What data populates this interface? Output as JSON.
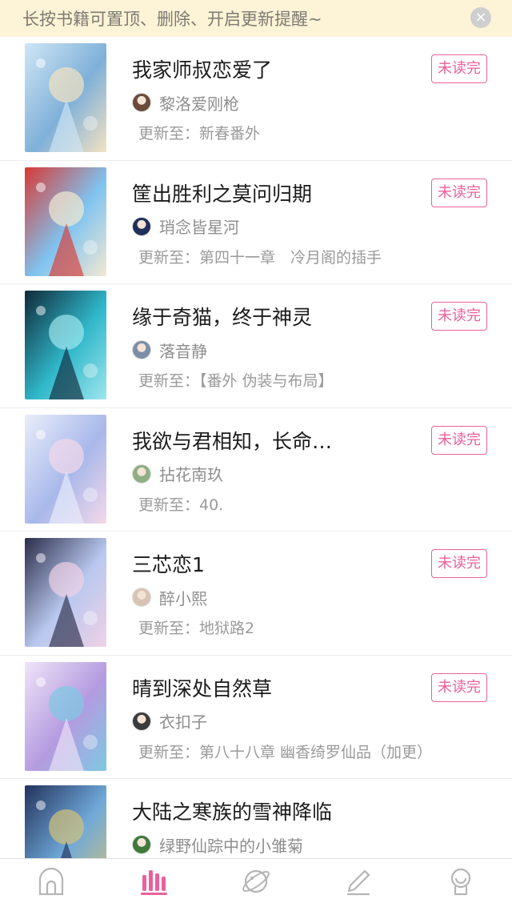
{
  "tip": {
    "text": "长按书籍可置顶、删除、开启更新提醒~",
    "close_icon": "×"
  },
  "books": [
    {
      "title": "我家师叔恋爱了",
      "author": "黎洛爱刚枪",
      "update": "更新至：新春番外",
      "badge": "未读完",
      "cover_colors": [
        "#cfe6f5",
        "#7fb0d9",
        "#f4e2c2"
      ],
      "avatar_color": "#6b4a3a"
    },
    {
      "title": "筐出胜利之莫问归期",
      "author": "琑念皆星河",
      "update": "更新至：第四十一章　冷月阁的插手",
      "badge": "未读完",
      "cover_colors": [
        "#d83a35",
        "#7fc3f0",
        "#f3e9d2"
      ],
      "avatar_color": "#1f2f5a"
    },
    {
      "title": "缘于奇猫，终于神灵",
      "author": "落音静",
      "update": "更新至：【番外 伪装与布局】",
      "badge": "未读完",
      "cover_colors": [
        "#0f2a3a",
        "#2fb7c9",
        "#9fe6ee"
      ],
      "avatar_color": "#7a8fa6"
    },
    {
      "title": "我欲与君相知，长命…",
      "author": "拈花南玖",
      "update": "更新至：40.",
      "badge": "未读完",
      "cover_colors": [
        "#e9eefb",
        "#a8b8ea",
        "#f4d9ea"
      ],
      "avatar_color": "#8fae84"
    },
    {
      "title": "三芯恋1",
      "author": "醉小熙",
      "update": "更新至：地狱路2",
      "badge": "未读完",
      "cover_colors": [
        "#2b2d4a",
        "#b9c8ef",
        "#f0d1e6"
      ],
      "avatar_color": "#d9c3b4"
    },
    {
      "title": "晴到深处自然草",
      "author": "衣扣子",
      "update": "更新至：第八十八章 幽香绮罗仙品（加更）",
      "badge": "未读完",
      "cover_colors": [
        "#efe4f8",
        "#b49be0",
        "#7ec9e3"
      ],
      "avatar_color": "#3b3b3b"
    },
    {
      "title": "大陆之寒族的雪神降临",
      "author": "绿野仙踪中的小雏菊",
      "update": "",
      "badge": "",
      "cover_colors": [
        "#24325e",
        "#6fa9d8",
        "#d3c27a"
      ],
      "avatar_color": "#3f7a3c"
    }
  ],
  "tabs": [
    {
      "name": "home-icon",
      "active": false
    },
    {
      "name": "bookshelf-icon",
      "active": true
    },
    {
      "name": "discover-planet-icon",
      "active": false
    },
    {
      "name": "write-pencil-icon",
      "active": false
    },
    {
      "name": "profile-icon",
      "active": false
    }
  ],
  "colors": {
    "accent": "#e9619c",
    "tip_bg": "#fdf3d6",
    "text_gray": "#9a9a9a",
    "tab_inactive": "#b5b5b5"
  }
}
